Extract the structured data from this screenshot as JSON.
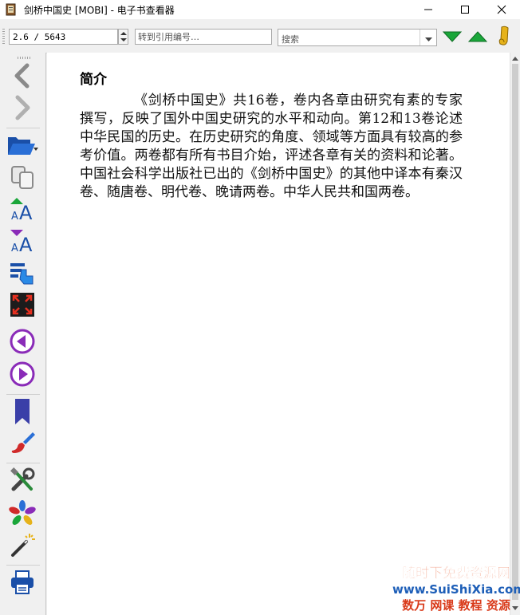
{
  "window": {
    "title": "剑桥中国史 [MOBI] - 电子书查看器",
    "minimize_label": "—",
    "maximize_label": "☐",
    "close_label": "✕"
  },
  "toolbar": {
    "position_value": "2.6 / 5643",
    "reference_placeholder": "转到引用编号…",
    "search_placeholder": "搜索",
    "icons": [
      "find-next-icon",
      "find-previous-icon",
      "bookmark-ribbon-icon"
    ]
  },
  "sidebar": {
    "items": [
      "back-icon",
      "forward-icon",
      "open-book-icon",
      "copy-icon",
      "font-larger-icon",
      "font-smaller-icon",
      "reference-mode-icon",
      "fullscreen-icon",
      "previous-page-icon",
      "next-page-icon",
      "bookmark-icon",
      "theme-icon",
      "preferences-icon",
      "metadata-icon",
      "inspector-icon",
      "print-icon"
    ]
  },
  "document": {
    "heading": "简介",
    "body": "《剑桥中国史》共16卷，卷内各章由研究有素的专家撰写，反映了国外中国史研究的水平和动向。第12和13卷论述中华民国的历史。在历史研究的角度、领域等方面具有较高的参考价值。两卷都有所有书目介始，评述各章有关的资料和论著。中国社会科学出版社已出的《剑桥中国史》的其他中译本有秦汉卷、随唐卷、明代卷、晚请两卷。中华人民共和国两卷。"
  },
  "watermark": {
    "line1": "随时下免费资源网",
    "line2": "www.SuiShiXia.com",
    "line3": "数万 网课 教程 资源"
  },
  "colors": {
    "accent_green": "#1aa63a",
    "accent_blue": "#2a6fd6",
    "accent_purple": "#8a2bb8",
    "watermark_orange": "#e8501f"
  }
}
